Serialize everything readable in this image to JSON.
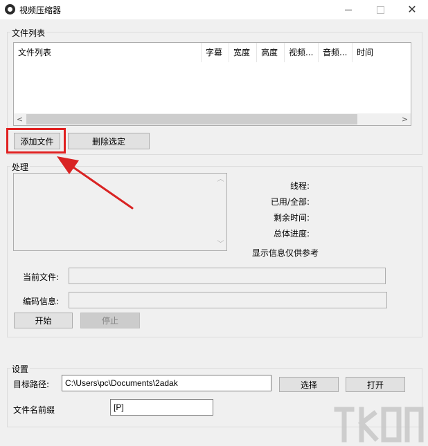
{
  "window": {
    "title": "视频压缩器"
  },
  "file_list": {
    "group_label": "文件列表",
    "columns": [
      "文件列表",
      "字幕",
      "宽度",
      "高度",
      "视频...",
      "音频...",
      "时间"
    ],
    "add_button": "添加文件",
    "delete_button": "删除选定"
  },
  "processing": {
    "group_label": "处理",
    "info": {
      "threads_label": "线程:",
      "used_total_label": "已用/全部:",
      "remaining_time_label": "剩余时间:",
      "overall_progress_label": "总体进度:",
      "note": "显示信息仅供参考"
    },
    "current_file_label": "当前文件:",
    "encoding_info_label": "编码信息:",
    "start_button": "开始",
    "stop_button": "停止"
  },
  "settings": {
    "group_label": "设置",
    "target_path_label": "目标路径:",
    "target_path_value": "C:\\Users\\pc\\Documents\\2adak",
    "select_button": "选择",
    "open_button": "打开",
    "prefix_label": "文件名前缀",
    "prefix_value": "[P]"
  },
  "colors": {
    "highlight": "#e02020",
    "arrow": "#d92323"
  },
  "icons": {
    "app": "camera-lens-icon",
    "scroll_left": "chevron-left-icon",
    "scroll_right": "chevron-right-icon"
  }
}
